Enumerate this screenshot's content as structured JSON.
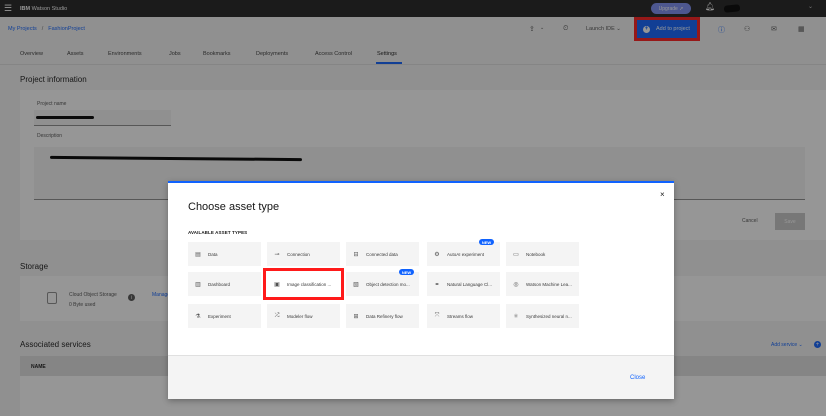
{
  "topbar": {
    "brand_prefix": "IBM",
    "brand_name": "Watson Studio",
    "upgrade_label": "Upgrade"
  },
  "header": {
    "breadcrumb": [
      "My Projects",
      "FashionProject"
    ],
    "launch_ide_label": "Launch IDE",
    "add_to_project_label": "Add to project"
  },
  "tabs": [
    "Overview",
    "Assets",
    "Environments",
    "Jobs",
    "Bookmarks",
    "Deployments",
    "Access Control",
    "Settings"
  ],
  "active_tab": "Settings",
  "project_info": {
    "title": "Project information",
    "name_label": "Project name",
    "description_label": "Description",
    "cancel_label": "Cancel",
    "save_label": "Save"
  },
  "storage": {
    "title": "Storage",
    "name": "Cloud Object Storage",
    "used": "0 Byte used",
    "manage_label": "Manage"
  },
  "services": {
    "title": "Associated services",
    "add_label": "Add service",
    "name_column": "NAME"
  },
  "modal": {
    "title": "Choose asset type",
    "section_label": "AVAILABLE ASSET TYPES",
    "close_label": "Close",
    "new_badge": "NEW",
    "tiles": [
      {
        "label": "Data",
        "icon": "data-icon"
      },
      {
        "label": "Connection",
        "icon": "connection-icon"
      },
      {
        "label": "Connected data",
        "icon": "connected-data-icon"
      },
      {
        "label": "AutoAI experiment",
        "icon": "autoai-icon"
      },
      {
        "label": "Notebook",
        "icon": "notebook-icon"
      },
      {
        "label": "Dashboard",
        "icon": "dashboard-icon"
      },
      {
        "label": "Image classification ...",
        "icon": "image-classification-icon"
      },
      {
        "label": "Object detection mo...",
        "icon": "object-detection-icon"
      },
      {
        "label": "Natural Language Cl...",
        "icon": "natural-language-icon"
      },
      {
        "label": "Watson Machine Lea...",
        "icon": "watson-ml-icon"
      },
      {
        "label": "Experiment",
        "icon": "experiment-icon"
      },
      {
        "label": "Modeler flow",
        "icon": "modeler-flow-icon"
      },
      {
        "label": "Data Refinery flow",
        "icon": "data-refinery-icon"
      },
      {
        "label": "Streams flow",
        "icon": "streams-flow-icon"
      },
      {
        "label": "Synthesized neural n...",
        "icon": "synthesized-neural-icon"
      }
    ]
  },
  "colors": {
    "accent": "#0f62fe",
    "highlight": "#ff1a1a",
    "topbar": "#1f1f1f"
  }
}
